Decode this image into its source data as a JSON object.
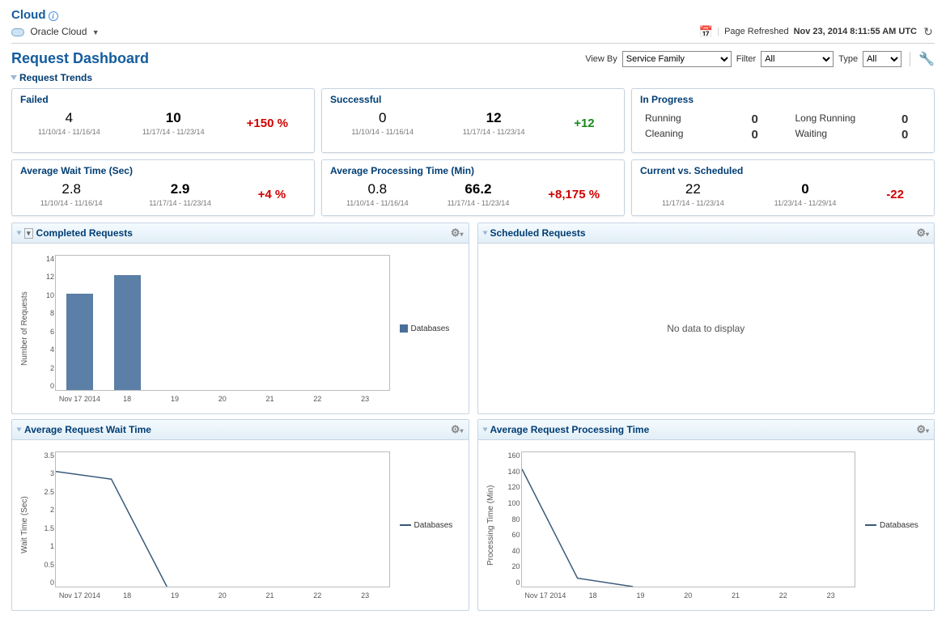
{
  "header": {
    "cloud_label": "Cloud",
    "breadcrumb": "Oracle Cloud",
    "refresh_label": "Page Refreshed",
    "refresh_time": "Nov 23, 2014 8:11:55 AM UTC"
  },
  "dashboard": {
    "title": "Request Dashboard",
    "view_by_label": "View By",
    "view_by_value": "Service Family",
    "filter_label": "Filter",
    "filter_value": "All",
    "type_label": "Type",
    "type_value": "All"
  },
  "trends_section": "Request Trends",
  "cards": {
    "failed": {
      "title": "Failed",
      "prev": "4",
      "prev_range": "11/10/14 - 11/16/14",
      "curr": "10",
      "curr_range": "11/17/14 - 11/23/14",
      "delta": "+150 %"
    },
    "successful": {
      "title": "Successful",
      "prev": "0",
      "prev_range": "11/10/14 - 11/16/14",
      "curr": "12",
      "curr_range": "11/17/14 - 11/23/14",
      "delta": "+12"
    },
    "in_progress": {
      "title": "In Progress",
      "running_label": "Running",
      "running": "0",
      "cleaning_label": "Cleaning",
      "cleaning": "0",
      "long_running_label": "Long Running",
      "long_running": "0",
      "waiting_label": "Waiting",
      "waiting": "0"
    },
    "avg_wait": {
      "title": "Average Wait Time (Sec)",
      "prev": "2.8",
      "prev_range": "11/10/14 - 11/16/14",
      "curr": "2.9",
      "curr_range": "11/17/14 - 11/23/14",
      "delta": "+4 %"
    },
    "avg_proc": {
      "title": "Average Processing Time (Min)",
      "prev": "0.8",
      "prev_range": "11/10/14 - 11/16/14",
      "curr": "66.2",
      "curr_range": "11/17/14 - 11/23/14",
      "delta": "+8,175 %"
    },
    "cvs": {
      "title": "Current vs. Scheduled",
      "prev": "22",
      "prev_range": "11/17/14 - 11/23/14",
      "curr": "0",
      "curr_range": "11/23/14 - 11/29/14",
      "delta": "-22"
    }
  },
  "panels": {
    "completed": "Completed Requests",
    "scheduled": "Scheduled Requests",
    "scheduled_empty": "No data to display",
    "avg_wait": "Average Request Wait Time",
    "avg_proc": "Average Request Processing Time",
    "legend_db": "Databases",
    "ylabel_count": "Number of Requests",
    "ylabel_wait": "Wait Time (Sec)",
    "ylabel_proc": "Processing Time (Min)"
  },
  "chart_data": [
    {
      "type": "bar",
      "title": "Completed Requests",
      "ylabel": "Number of Requests",
      "categories": [
        "Nov 17 2014",
        "18",
        "19",
        "20",
        "21",
        "22",
        "23"
      ],
      "series": [
        {
          "name": "Databases",
          "values": [
            10,
            12,
            null,
            null,
            null,
            null,
            null
          ]
        }
      ],
      "ylim": [
        0,
        14
      ],
      "yticks": [
        0,
        2,
        4,
        6,
        8,
        10,
        12,
        14
      ]
    },
    {
      "type": "line",
      "title": "Average Request Wait Time",
      "ylabel": "Wait Time (Sec)",
      "categories": [
        "Nov 17 2014",
        "18",
        "19",
        "20",
        "21",
        "22",
        "23"
      ],
      "series": [
        {
          "name": "Databases",
          "values": [
            3.0,
            2.8,
            0,
            null,
            null,
            null,
            null
          ]
        }
      ],
      "ylim": [
        0,
        3.5
      ],
      "yticks": [
        0.0,
        0.5,
        1.0,
        1.5,
        2.0,
        2.5,
        3.0,
        3.5
      ]
    },
    {
      "type": "line",
      "title": "Average Request Processing Time",
      "ylabel": "Processing Time (Min)",
      "categories": [
        "Nov 17 2014",
        "18",
        "19",
        "20",
        "21",
        "22",
        "23"
      ],
      "series": [
        {
          "name": "Databases",
          "values": [
            140,
            10,
            0,
            null,
            null,
            null,
            null
          ]
        }
      ],
      "ylim": [
        0,
        160
      ],
      "yticks": [
        0,
        20,
        40,
        60,
        80,
        100,
        120,
        140,
        160
      ]
    }
  ]
}
